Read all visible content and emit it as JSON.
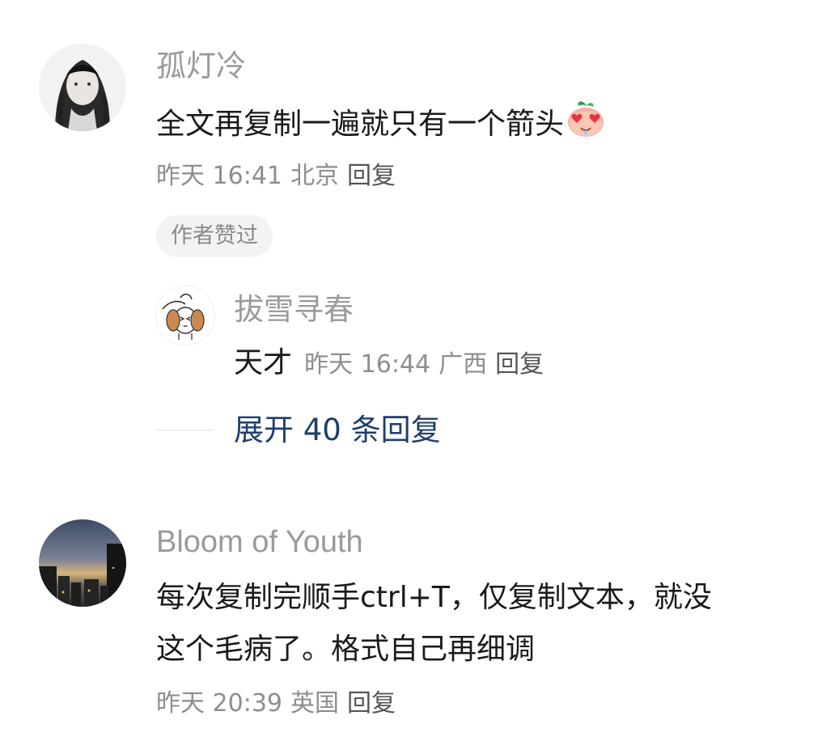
{
  "comments": [
    {
      "username": "孤灯冷",
      "text": "全文再复制一遍就只有一个箭头",
      "emoji_icon": "heart-eyes-peach-icon",
      "time": "昨天 16:41",
      "location": "北京",
      "reply_label": "回复",
      "badge": "作者赞过",
      "replies": [
        {
          "username": "拔雪寻春",
          "text": "天才",
          "time": "昨天 16:44",
          "location": "广西",
          "reply_label": "回复"
        }
      ],
      "expand_label": "展开 40 条回复"
    },
    {
      "username": "Bloom of Youth",
      "text_line1": "每次复制完顺手ctrl+T，仅复制文本，就没",
      "text_line2": "这个毛病了。格式自己再细调",
      "time": "昨天 20:39",
      "location": "英国",
      "reply_label": "回复"
    }
  ],
  "colors": {
    "name": "#9a9a9a",
    "text": "#1a1a1a",
    "meta": "#8e8e8e",
    "expand": "#1f3e6b",
    "badge_bg": "#f3f3f3"
  }
}
